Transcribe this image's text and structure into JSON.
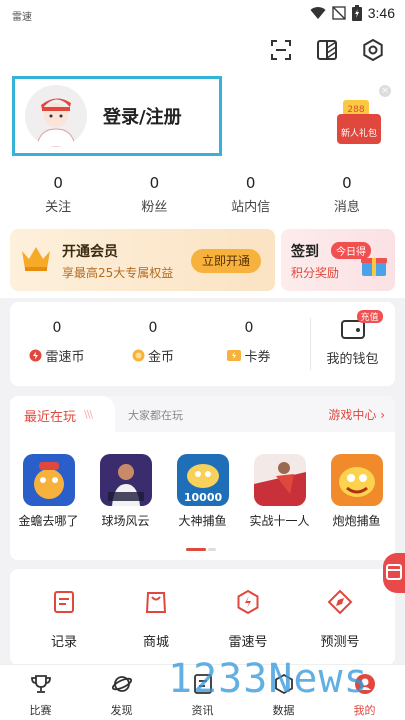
{
  "status_bar": {
    "app_name": "雷速",
    "time": "3:46"
  },
  "profile": {
    "login_label": "登录/注册",
    "gift_amount": "288",
    "gift_label": "新人礼包"
  },
  "stats": [
    {
      "value": "0",
      "label": "关注"
    },
    {
      "value": "0",
      "label": "粉丝"
    },
    {
      "value": "0",
      "label": "站内信"
    },
    {
      "value": "0",
      "label": "消息"
    }
  ],
  "vip": {
    "title": "开通会员",
    "subtitle": "享最高25大专属权益",
    "button": "立即开通"
  },
  "sign_in": {
    "title": "签到",
    "tag": "今日得",
    "subtitle": "积分奖励"
  },
  "wallet": {
    "items": [
      {
        "value": "0",
        "label": "雷速币"
      },
      {
        "value": "0",
        "label": "金币"
      },
      {
        "value": "0",
        "label": "卡券"
      }
    ],
    "wallet_tag": "充值",
    "wallet_label": "我的钱包"
  },
  "games": {
    "tab_active": "最近在玩",
    "tab_other": "大家都在玩",
    "center_link": "游戏中心 ›",
    "list": [
      {
        "name": "金蟾去哪了",
        "icon": "golden-toad-game-icon"
      },
      {
        "name": "球场风云",
        "icon": "football-stadium-game-icon"
      },
      {
        "name": "大神捕鱼",
        "icon": "fishing-game-icon",
        "badge": "10000"
      },
      {
        "name": "实战十一人",
        "icon": "eleven-players-game-icon"
      },
      {
        "name": "炮炮捕鱼",
        "icon": "cannon-fishing-game-icon"
      }
    ]
  },
  "tools": [
    {
      "label": "记录",
      "icon": "record-icon"
    },
    {
      "label": "商城",
      "icon": "shop-bag-icon"
    },
    {
      "label": "雷速号",
      "icon": "lightning-icon"
    },
    {
      "label": "预测号",
      "icon": "compass-icon"
    }
  ],
  "tab_bar": [
    {
      "label": "比赛",
      "icon": "trophy-icon"
    },
    {
      "label": "发现",
      "icon": "planet-icon"
    },
    {
      "label": "资讯",
      "icon": "news-icon"
    },
    {
      "label": "数据",
      "icon": "data-icon"
    },
    {
      "label": "我的",
      "icon": "profile-icon",
      "active": true
    }
  ],
  "watermark": "1233News",
  "colors": {
    "accent": "#e0483e",
    "highlight_border": "#35b3d8",
    "vip_button": "#f7b23e"
  }
}
